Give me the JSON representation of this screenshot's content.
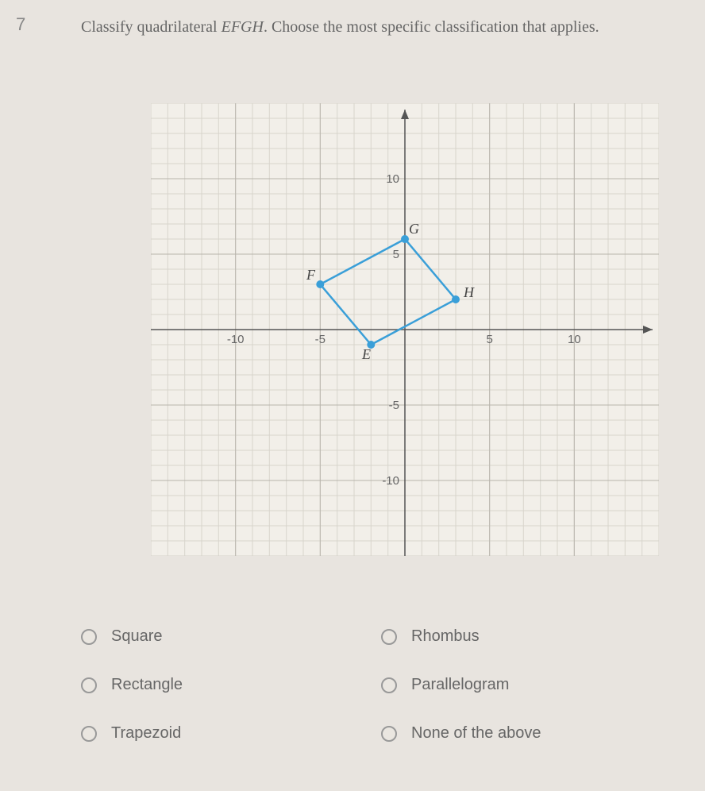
{
  "question_number": "7",
  "question_prefix": "Classify quadrilateral ",
  "question_shape": "EFGH",
  "question_suffix": ". Choose the most specific classification that applies.",
  "chart_data": {
    "type": "scatter",
    "title": "",
    "xlabel": "",
    "ylabel": "",
    "xlim": [
      -15,
      15
    ],
    "ylim": [
      -15,
      15
    ],
    "x_ticks": [
      -10,
      -5,
      5,
      10
    ],
    "y_ticks": [
      -10,
      -5,
      5,
      10
    ],
    "points": [
      {
        "name": "E",
        "x": -2,
        "y": -1
      },
      {
        "name": "F",
        "x": -5,
        "y": 3
      },
      {
        "name": "G",
        "x": 0,
        "y": 6
      },
      {
        "name": "H",
        "x": 3,
        "y": 2
      }
    ],
    "shape": "quadrilateral",
    "connect_order": [
      "E",
      "F",
      "G",
      "H",
      "E"
    ]
  },
  "options": {
    "a": "Square",
    "b": "Rhombus",
    "c": "Rectangle",
    "d": "Parallelogram",
    "e": "Trapezoid",
    "f": "None of the above"
  }
}
